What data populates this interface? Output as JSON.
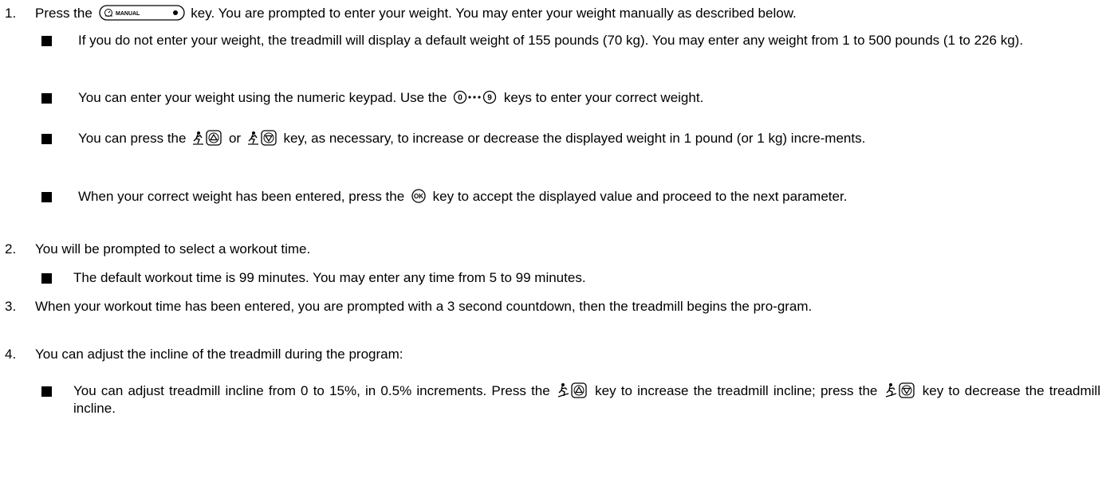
{
  "step1": {
    "num": "1.",
    "pre": "Press the",
    "manual_key": "MANUAL",
    "post": "key. You are prompted to enter your weight. You may enter your weight manually as described below."
  },
  "b1": {
    "text": "If you do not enter your weight, the treadmill will display a default weight of 155 pounds (70 kg). You may enter any weight from 1 to 500 pounds (1 to 226 kg)."
  },
  "b2": {
    "pre": "You can enter your weight using the numeric keypad. Use the",
    "key_start": "0",
    "key_end": "9",
    "post": "keys to enter your correct weight."
  },
  "b3": {
    "pre": "You can press the",
    "mid": "or",
    "post": "key, as necessary, to increase or decrease the displayed weight in 1 pound (or 1 kg) incre-ments."
  },
  "b4": {
    "pre": "When your correct weight has been entered, press the",
    "ok_key": "OK",
    "post": "key to accept the displayed value and proceed to the next parameter."
  },
  "step2": {
    "num": "2.",
    "text": "You will be prompted to select a workout time."
  },
  "b5": {
    "text": "The default workout time is 99 minutes. You may enter any time from 5 to 99 minutes."
  },
  "step3": {
    "num": "3.",
    "text": "When your workout time has been entered, you are prompted with a 3 second countdown, then the treadmill begins the pro-gram."
  },
  "step4": {
    "num": "4.",
    "text": "You can adjust the incline of the treadmill during the program:"
  },
  "b6": {
    "pre": "You can adjust treadmill incline from 0 to 15%, in 0.5% increments. Press the",
    "mid": "key to increase the treadmill incline; press the",
    "post": "key to decrease the treadmill incline."
  },
  "icons": {
    "manual_key": "manual-key-icon",
    "digit_keys": "digit-keys-icon",
    "speed_up": "speed-up-key-icon",
    "speed_down": "speed-down-key-icon",
    "ok": "ok-key-icon",
    "incline_up": "incline-up-key-icon",
    "incline_down": "incline-down-key-icon"
  }
}
